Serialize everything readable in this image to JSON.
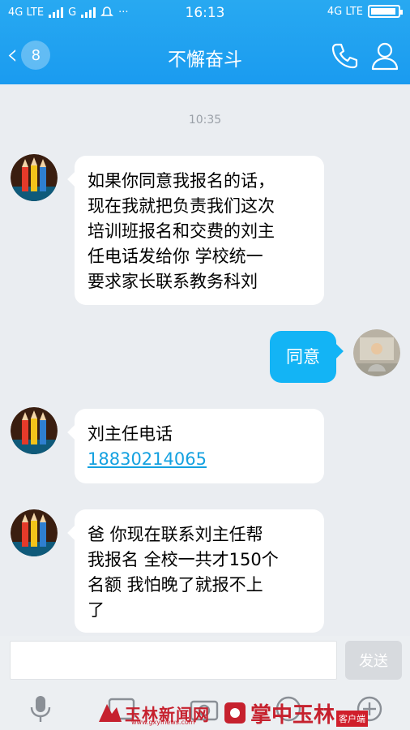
{
  "status": {
    "left_net1": "4G LTE",
    "left_net2": "G",
    "dots": "···",
    "time": "16:13",
    "right_net": "4G LTE",
    "battery_level": 0.95
  },
  "header": {
    "unread_count": "8",
    "title": "不懈奋斗"
  },
  "chat": {
    "timestamp": "10:35",
    "messages": [
      {
        "side": "left",
        "lines": [
          "如果你同意我报名的话，",
          "现在我就把负责我们这次",
          "培训班报名和交费的刘主",
          "任电话发给你 学校统一",
          "要求家长联系教务科刘"
        ]
      },
      {
        "side": "right",
        "text": "同意"
      },
      {
        "side": "left",
        "line1": "刘主任电话",
        "phone": "18830214065"
      },
      {
        "side": "left",
        "lines": [
          "爸 你现在联系刘主任帮",
          "我报名 全校一共才150个",
          "名额 我怕晚了就报不上",
          "了"
        ]
      }
    ]
  },
  "input": {
    "placeholder": "",
    "send_label": "发送"
  },
  "watermark": {
    "site_name": "玉林新闻网",
    "site_url": "www.gxylnews.com",
    "app_name": "掌中玉林",
    "app_tag": "客户端"
  },
  "colors": {
    "header": "#1a9bf0",
    "bubble_blue": "#13b4f5",
    "link": "#14a1e0",
    "background": "#eaedf1"
  }
}
